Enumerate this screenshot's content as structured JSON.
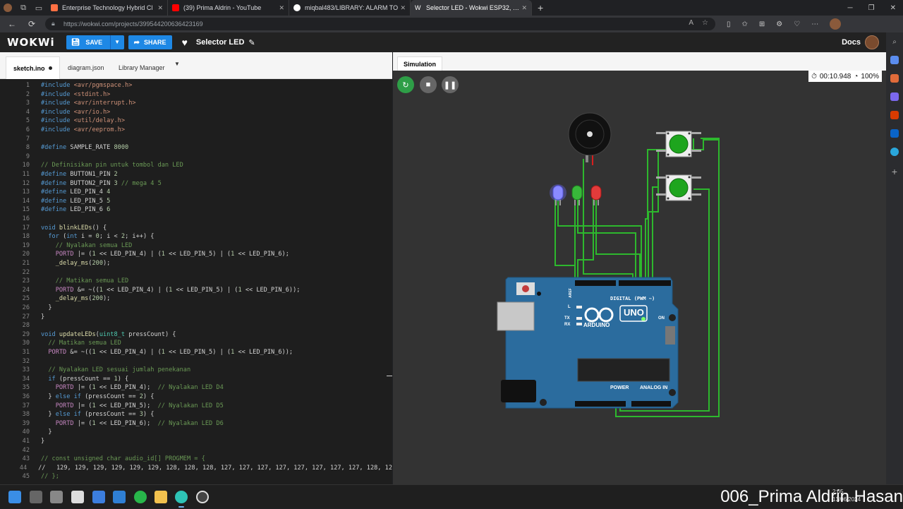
{
  "browser": {
    "tabs": [
      {
        "title": "Enterprise Technology Hybrid Cl",
        "color": "#ff7043"
      },
      {
        "title": "(39) Prima Aldrin - YouTube",
        "color": "#ff0000"
      },
      {
        "title": "miqbal483/LIBRARY: ALARM TO",
        "color": "#ffffff"
      },
      {
        "title": "Selector LED - Wokwi ESP32, STM",
        "color": "#ffffff"
      }
    ],
    "url": "https://wokwi.com/projects/399544200636423169"
  },
  "header": {
    "logo": "WOKWi",
    "save_label": "SAVE",
    "share_label": "SHARE",
    "project_name": "Selector LED",
    "docs_label": "Docs"
  },
  "editor": {
    "tabs": [
      "sketch.ino",
      "diagram.json",
      "Library Manager"
    ],
    "lines": [
      {
        "n": "1",
        "html": "<span class='c-pre'>#include</span> <span class='c-inc'>&lt;avr/pgmspace.h&gt;</span>"
      },
      {
        "n": "2",
        "html": "<span class='c-pre'>#include</span> <span class='c-inc'>&lt;stdint.h&gt;</span>"
      },
      {
        "n": "3",
        "html": "<span class='c-pre'>#include</span> <span class='c-inc'>&lt;avr/interrupt.h&gt;</span>"
      },
      {
        "n": "4",
        "html": "<span class='c-pre'>#include</span> <span class='c-inc'>&lt;avr/io.h&gt;</span>"
      },
      {
        "n": "5",
        "html": "<span class='c-pre'>#include</span> <span class='c-inc'>&lt;util/delay.h&gt;</span>"
      },
      {
        "n": "6",
        "html": "<span class='c-pre'>#include</span> <span class='c-inc'>&lt;avr/eeprom.h&gt;</span>"
      },
      {
        "n": "7",
        "html": ""
      },
      {
        "n": "8",
        "html": "<span class='c-pre'>#define</span> SAMPLE_RATE <span class='c-num'>8000</span>"
      },
      {
        "n": "9",
        "html": ""
      },
      {
        "n": "10",
        "html": "<span class='c-cm'>// Definisikan pin untuk tombol dan LED</span>"
      },
      {
        "n": "11",
        "html": "<span class='c-pre'>#define</span> BUTTON1_PIN <span class='c-num'>2</span>"
      },
      {
        "n": "12",
        "html": "<span class='c-pre'>#define</span> BUTTON2_PIN <span class='c-num'>3</span> <span class='c-cm'>// mega 4 5</span>"
      },
      {
        "n": "13",
        "html": "<span class='c-pre'>#define</span> LED_PIN_4 <span class='c-num'>4</span>"
      },
      {
        "n": "14",
        "html": "<span class='c-pre'>#define</span> LED_PIN_5 <span class='c-num'>5</span>"
      },
      {
        "n": "15",
        "html": "<span class='c-pre'>#define</span> LED_PIN_6 <span class='c-num'>6</span>"
      },
      {
        "n": "16",
        "html": ""
      },
      {
        "n": "17",
        "html": "<span class='c-kw'>void</span> <span class='c-fn'>blinkLEDs</span>() {"
      },
      {
        "n": "18",
        "html": "  <span class='c-kw'>for</span> (<span class='c-kw'>int</span> i = <span class='c-num'>0</span>; i &lt; <span class='c-num'>2</span>; i++) {"
      },
      {
        "n": "19",
        "html": "    <span class='c-cm'>// Nyalakan semua LED</span>"
      },
      {
        "n": "20",
        "html": "    <span class='c-reg'>PORTD</span> |= (<span class='c-num'>1</span> &lt;&lt; LED_PIN_4) | (<span class='c-num'>1</span> &lt;&lt; LED_PIN_5) | (<span class='c-num'>1</span> &lt;&lt; LED_PIN_6);"
      },
      {
        "n": "21",
        "html": "    <span class='c-fn'>_delay_ms</span>(<span class='c-num'>200</span>);"
      },
      {
        "n": "22",
        "html": ""
      },
      {
        "n": "23",
        "html": "    <span class='c-cm'>// Matikan semua LED</span>"
      },
      {
        "n": "24",
        "html": "    <span class='c-reg'>PORTD</span> &amp;= ~((<span class='c-num'>1</span> &lt;&lt; LED_PIN_4) | (<span class='c-num'>1</span> &lt;&lt; LED_PIN_5) | (<span class='c-num'>1</span> &lt;&lt; LED_PIN_6));"
      },
      {
        "n": "25",
        "html": "    <span class='c-fn'>_delay_ms</span>(<span class='c-num'>200</span>);"
      },
      {
        "n": "26",
        "html": "  }"
      },
      {
        "n": "27",
        "html": "}"
      },
      {
        "n": "28",
        "html": ""
      },
      {
        "n": "29",
        "html": "<span class='c-kw'>void</span> <span class='c-fn'>updateLEDs</span>(<span class='c-ty'>uint8_t</span> pressCount) {"
      },
      {
        "n": "30",
        "html": "  <span class='c-cm'>// Matikan semua LED</span>"
      },
      {
        "n": "31",
        "html": "  <span class='c-reg'>PORTD</span> &amp;= ~((<span class='c-num'>1</span> &lt;&lt; LED_PIN_4) | (<span class='c-num'>1</span> &lt;&lt; LED_PIN_5) | (<span class='c-num'>1</span> &lt;&lt; LED_PIN_6));"
      },
      {
        "n": "32",
        "html": ""
      },
      {
        "n": "33",
        "html": "  <span class='c-cm'>// Nyalakan LED sesuai jumlah penekanan</span>"
      },
      {
        "n": "34",
        "html": "  <span class='c-kw'>if</span> (pressCount == <span class='c-num'>1</span>) {"
      },
      {
        "n": "35",
        "html": "    <span class='c-reg'>PORTD</span> |= (<span class='c-num'>1</span> &lt;&lt; LED_PIN_4);  <span class='c-cm'>// Nyalakan LED D4</span>"
      },
      {
        "n": "36",
        "html": "  } <span class='c-kw'>else if</span> (pressCount == <span class='c-num'>2</span>) {"
      },
      {
        "n": "37",
        "html": "    <span class='c-reg'>PORTD</span> |= (<span class='c-num'>1</span> &lt;&lt; LED_PIN_5);  <span class='c-cm'>// Nyalakan LED D5</span>"
      },
      {
        "n": "38",
        "html": "  } <span class='c-kw'>else if</span> (pressCount == <span class='c-num'>3</span>) {"
      },
      {
        "n": "39",
        "html": "    <span class='c-reg'>PORTD</span> |= (<span class='c-num'>1</span> &lt;&lt; LED_PIN_6);  <span class='c-cm'>// Nyalakan LED D6</span>"
      },
      {
        "n": "40",
        "html": "  }"
      },
      {
        "n": "41",
        "html": "}"
      },
      {
        "n": "42",
        "html": ""
      },
      {
        "n": "43",
        "html": "<span class='c-cm'>// const unsigned char audio_id[] PROGMEM = {</span>"
      },
      {
        "n": "44",
        "html": "//   129, 129, 129, 129, 129, 129, 128, 128, 128, 127, 127, 127, 127, 127, 127, 127, 127, 128, 12"
      },
      {
        "n": "45",
        "html": "<span class='c-cm'>// };</span>"
      }
    ]
  },
  "simulation": {
    "tab_label": "Simulation",
    "timer": "00:10.948",
    "speed": "100%",
    "board": {
      "brand": "ARDUINO",
      "model": "UNO",
      "digital_label": "DIGITAL (PWM ~)",
      "power_label": "POWER",
      "analog_label": "ANALOG IN",
      "on_label": "ON",
      "tx": "TX",
      "rx": "RX",
      "l": "L",
      "aref": "AREF"
    },
    "colors": {
      "wire": "#2db82d",
      "wire_red": "#d81e1e",
      "board": "#2b6c9e",
      "button": "#1ea51e"
    }
  },
  "taskbar": {
    "watermark": "006_Prima Aldrin Hasan",
    "clock_time": "2:05",
    "clock_date": "13/06/2024"
  }
}
